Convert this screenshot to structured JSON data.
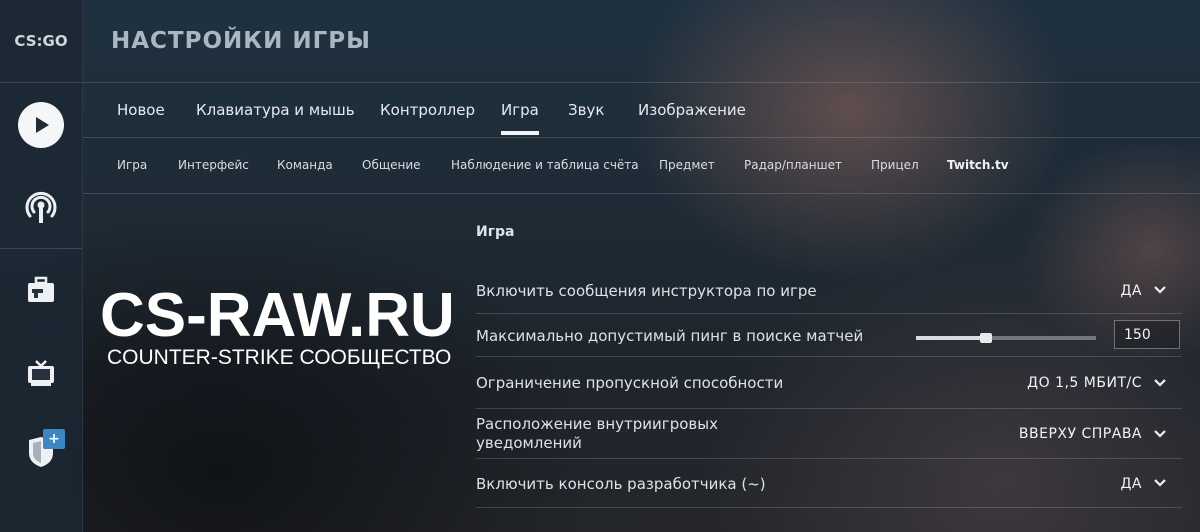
{
  "app": {
    "logo_text": "CS:GO"
  },
  "header": {
    "title": "НАСТРОЙКИ ИГРЫ"
  },
  "tabs": [
    {
      "label": "Новое",
      "active": false
    },
    {
      "label": "Клавиатура и мышь",
      "active": false
    },
    {
      "label": "Контроллер",
      "active": false
    },
    {
      "label": "Игра",
      "active": true
    },
    {
      "label": "Звук",
      "active": false
    },
    {
      "label": "Изображение",
      "active": false
    }
  ],
  "subtabs": [
    {
      "label": "Игра"
    },
    {
      "label": "Интерфейс"
    },
    {
      "label": "Команда"
    },
    {
      "label": "Общение"
    },
    {
      "label": "Наблюдение и таблица счёта"
    },
    {
      "label": "Предмет"
    },
    {
      "label": "Радар/планшет"
    },
    {
      "label": "Прицел"
    },
    {
      "label": "Twitch.tv"
    }
  ],
  "rail": {
    "icons": [
      "play-icon",
      "antenna-icon",
      "briefcase-icon",
      "tv-icon",
      "shield-icon"
    ],
    "badge": "+"
  },
  "watermark": {
    "main": "CS-RAW.RU",
    "sub": "COUNTER-STRIKE СООБЩЕСТВО"
  },
  "section": {
    "title": "Игра"
  },
  "settings": [
    {
      "label": "Включить сообщения инструктора по игре",
      "value": "ДА"
    },
    {
      "label": "Максимально допустимый пинг в поиске матчей",
      "value": "150",
      "slider_fraction": 0.39
    },
    {
      "label": "Ограничение пропускной способности",
      "value": "ДО 1,5 МБИТ/С"
    },
    {
      "label": "Расположение внутриигровых\nуведомлений",
      "value": "ВВЕРХУ СПРАВА"
    },
    {
      "label": "Включить консоль разработчика (~)",
      "value": "ДА"
    }
  ],
  "colors": {
    "accent_blue": "#3c86c4",
    "title_gray": "#a9b7c3"
  }
}
